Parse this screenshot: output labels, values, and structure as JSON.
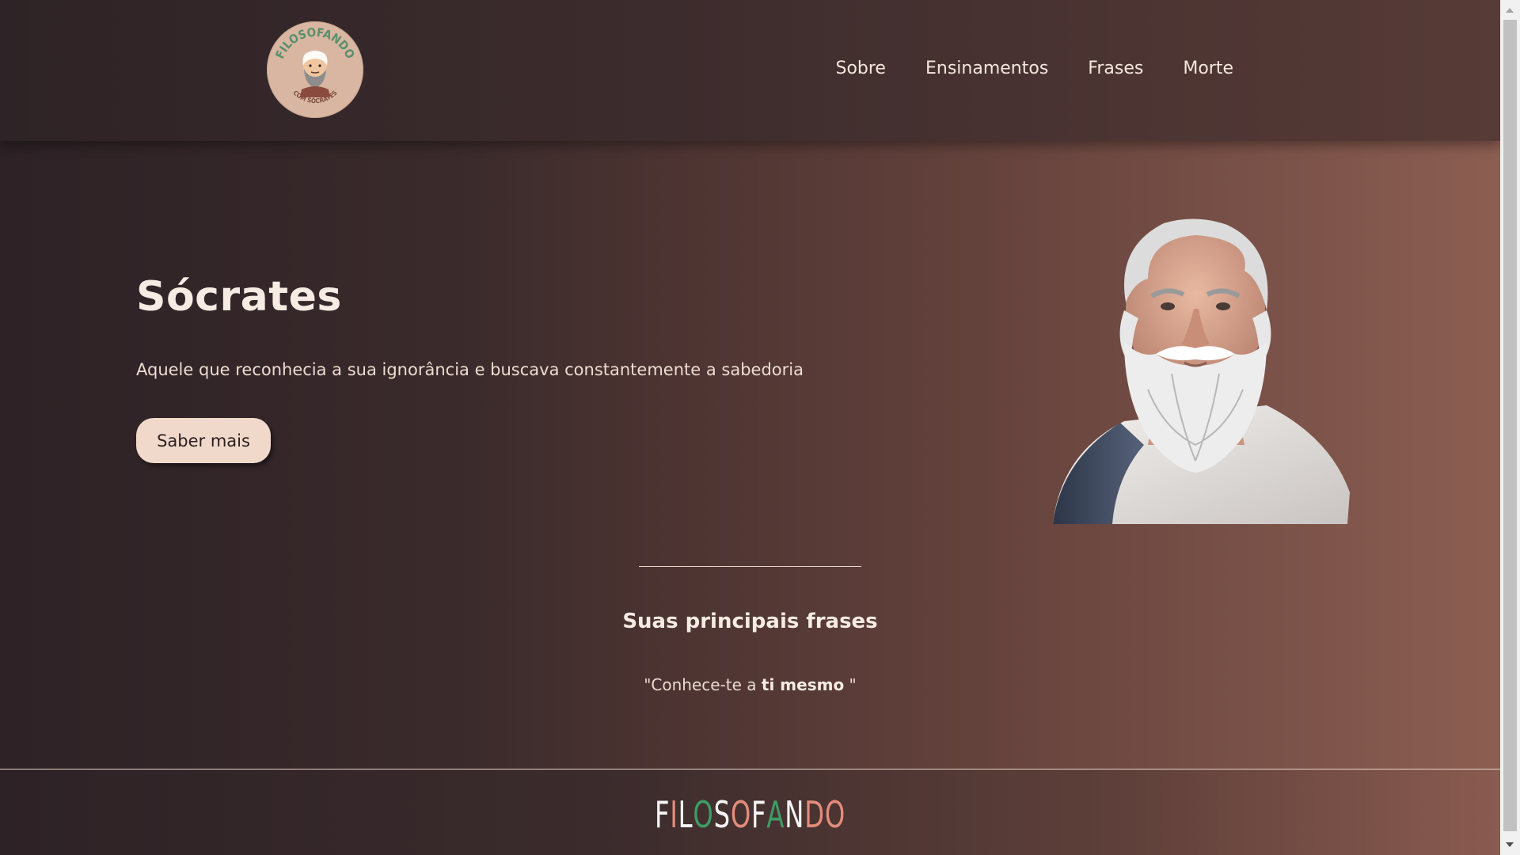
{
  "header": {
    "logo": {
      "text_top": "FILOSOFANDO",
      "text_bottom": "COM SÓCRATES",
      "icon": "socrates-cartoon-icon"
    },
    "nav": [
      {
        "label": "Sobre"
      },
      {
        "label": "Ensinamentos"
      },
      {
        "label": "Frases"
      },
      {
        "label": "Morte"
      }
    ]
  },
  "hero": {
    "title": "Sócrates",
    "subtitle": "Aquele que reconhecia a sua ignorância e buscava constantemente a sabedoria",
    "cta_label": "Saber mais",
    "portrait_icon": "socrates-bust-icon"
  },
  "quotes": {
    "title": "Suas principais frases",
    "quote_open": "\"Conhece-te a ",
    "quote_bold": "ti mesmo",
    "quote_close": " \""
  },
  "footer": {
    "letters": [
      "F",
      "I",
      "L",
      "O",
      "S",
      "O",
      "F",
      "A",
      "N",
      "D",
      "O"
    ],
    "letter_colors": [
      "#f5f5f5",
      "#e38c7c",
      "#f5f5f5",
      "#3f9b66",
      "#f5f5f5",
      "#e38c7c",
      "#f5f5f5",
      "#3f9b66",
      "#f5f5f5",
      "#e38c7c",
      "#e38c7c"
    ]
  },
  "colors": {
    "accent": "#f0d9cb",
    "text_light": "#f6ece4",
    "bg_dark": "#2d2226",
    "bg_warm": "#8c5e52"
  }
}
